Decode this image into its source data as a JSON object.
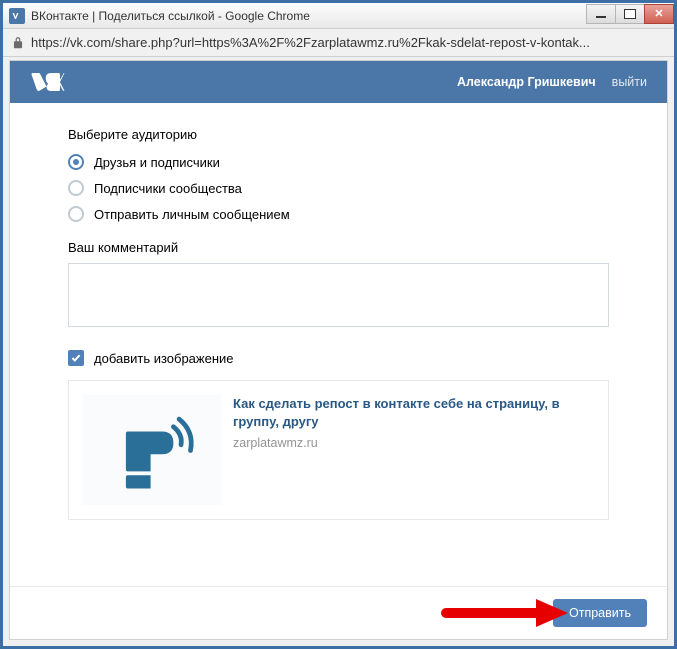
{
  "window": {
    "title": "ВКонтакте | Поделиться ссылкой - Google Chrome",
    "url": "https://vk.com/share.php?url=https%3A%2F%2Fzarplatawmz.ru%2Fkak-sdelat-repost-v-kontak..."
  },
  "header": {
    "username": "Александр Гришкевич",
    "logout_label": "выйти"
  },
  "audience": {
    "title": "Выберите аудиторию",
    "options": [
      {
        "label": "Друзья и подписчики",
        "selected": true
      },
      {
        "label": "Подписчики сообщества",
        "selected": false
      },
      {
        "label": "Отправить личным сообщением",
        "selected": false
      }
    ]
  },
  "comment": {
    "label": "Ваш комментарий",
    "value": ""
  },
  "add_image": {
    "label": "добавить изображение",
    "checked": true
  },
  "preview": {
    "title": "Как сделать репост в контакте себе на страницу, в группу, другу",
    "domain": "zarplatawmz.ru"
  },
  "footer": {
    "submit_label": "Отправить"
  }
}
